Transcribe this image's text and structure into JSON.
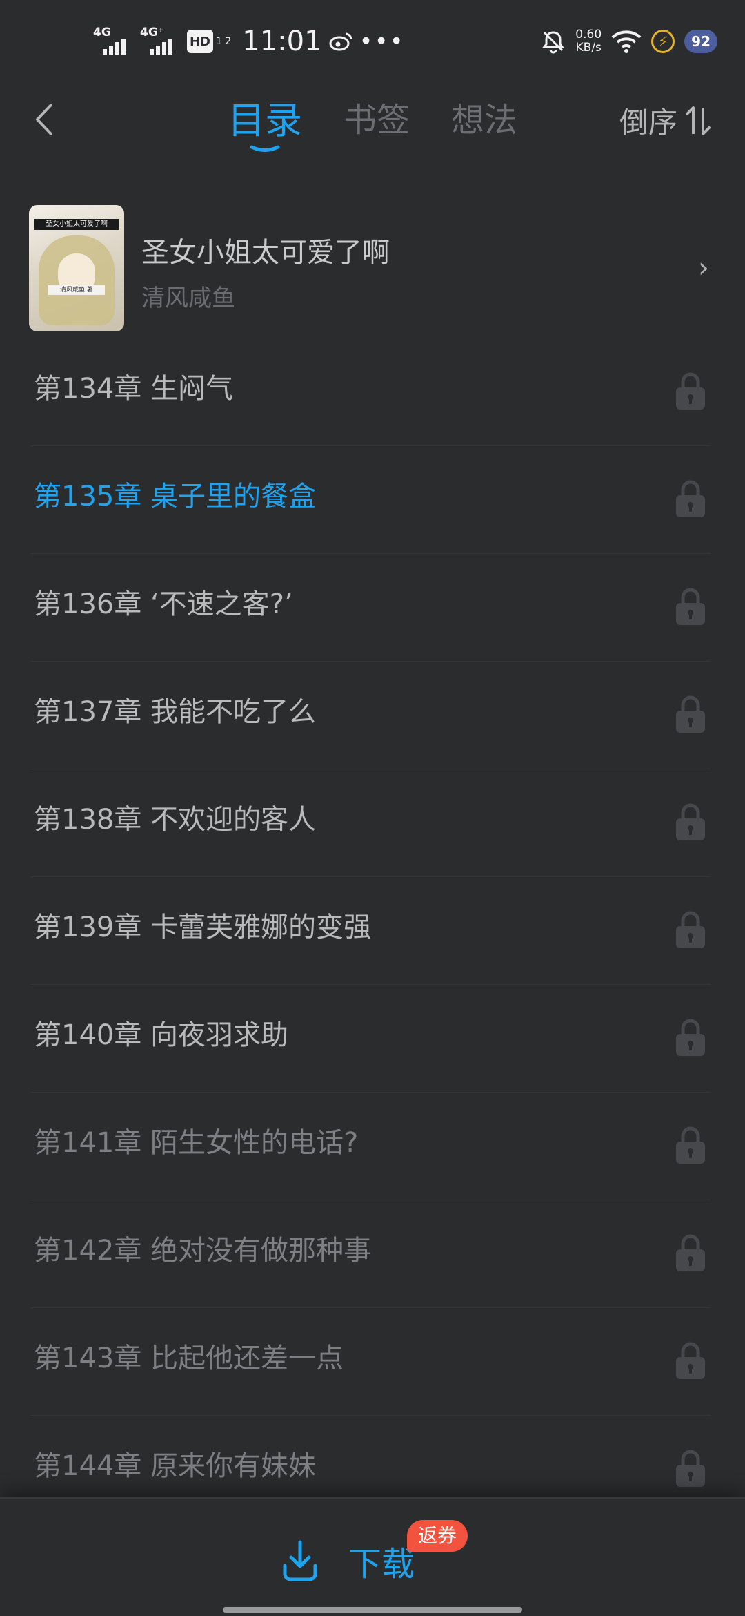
{
  "status_bar": {
    "sim1": "4G",
    "sim2": "4G⁺",
    "hd": "HD",
    "hd_sub": "1 2",
    "time": "11:01",
    "more": "•••",
    "net_speed_value": "0.60",
    "net_speed_unit": "KB/s",
    "battery": "92"
  },
  "header": {
    "tabs": [
      {
        "label": "目录",
        "active": true
      },
      {
        "label": "书签",
        "active": false
      },
      {
        "label": "想法",
        "active": false
      }
    ],
    "sort_label": "倒序"
  },
  "book": {
    "title": "圣女小姐太可爱了啊",
    "author": "清风咸鱼",
    "cover_banner": "圣女小姐太可爱了啊",
    "cover_tag": "清风咸鱼 著",
    "chevron": "›"
  },
  "chapters": [
    {
      "title": "第134章 生闷气",
      "state": "normal"
    },
    {
      "title": "第135章 桌子里的餐盒",
      "state": "current"
    },
    {
      "title": "第136章 ‘不速之客?’",
      "state": "normal"
    },
    {
      "title": "第137章 我能不吃了么",
      "state": "normal"
    },
    {
      "title": "第138章 不欢迎的客人",
      "state": "normal"
    },
    {
      "title": "第139章 卡蕾芙雅娜的变强",
      "state": "normal"
    },
    {
      "title": "第140章 向夜羽求助",
      "state": "normal"
    },
    {
      "title": "第141章 陌生女性的电话?",
      "state": "dim"
    },
    {
      "title": "第142章 绝对没有做那种事",
      "state": "dim"
    },
    {
      "title": "第143章 比起他还差一点",
      "state": "dim"
    },
    {
      "title": "第144章 原来你有妹妹",
      "state": "dim"
    }
  ],
  "bottom": {
    "download_label": "下载",
    "badge": "返券"
  },
  "colors": {
    "background": "#2b2c2e",
    "accent": "#1fa3ee",
    "badge": "#f1533e"
  },
  "icons": [
    "back-chevron-icon",
    "sort-arrows-icon",
    "lock-icon",
    "download-icon",
    "wifi-icon",
    "bell-off-icon",
    "weibo-icon",
    "charging-icon"
  ]
}
